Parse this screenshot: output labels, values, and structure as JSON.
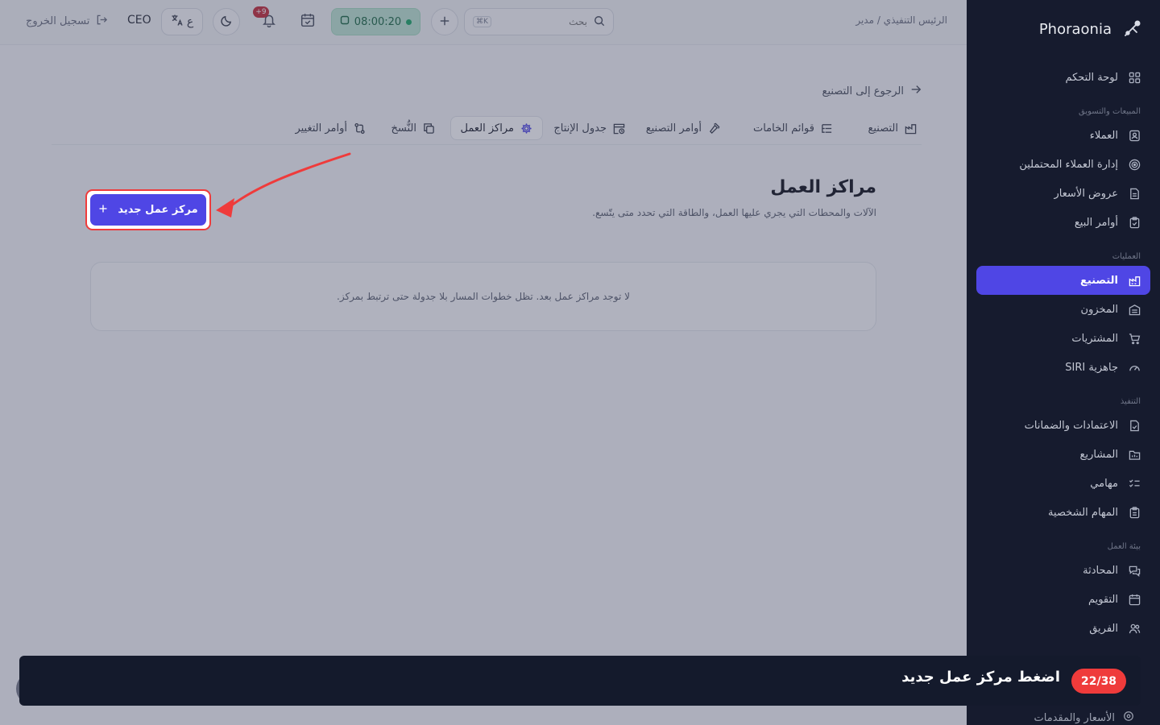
{
  "sidebar": {
    "brand": "Phoraonia",
    "items": [
      {
        "label": "لوحة التحكم",
        "icon": "grid-icon"
      },
      {
        "section": "المبيعات والتسويق"
      },
      {
        "label": "العملاء",
        "icon": "contact-icon"
      },
      {
        "label": "إدارة العملاء المحتملين",
        "icon": "target-icon"
      },
      {
        "label": "عروض الأسعار",
        "icon": "document-icon"
      },
      {
        "label": "أوامر البيع",
        "icon": "clipboard-icon"
      },
      {
        "section": "العمليات"
      },
      {
        "label": "التصنيع",
        "icon": "factory-icon",
        "active": true
      },
      {
        "label": "المخزون",
        "icon": "warehouse-icon"
      },
      {
        "label": "المشتريات",
        "icon": "cart-icon"
      },
      {
        "label": "جاهزية SIRI",
        "icon": "gauge-icon"
      },
      {
        "section": "التنفيذ"
      },
      {
        "label": "الاعتمادات والضمانات",
        "icon": "file-check-icon"
      },
      {
        "label": "المشاريع",
        "icon": "folder-icon"
      },
      {
        "label": "مهامي",
        "icon": "checklist-icon"
      },
      {
        "label": "المهام الشخصية",
        "icon": "clipboard-list-icon"
      },
      {
        "section": "بيئة العمل"
      },
      {
        "label": "المحادثة",
        "icon": "chat-icon"
      },
      {
        "label": "التقويم",
        "icon": "calendar-icon"
      },
      {
        "label": "الفريق",
        "icon": "users-icon"
      }
    ],
    "peek_label": "الأسعار والمقدمات"
  },
  "topbar": {
    "breadcrumb": "الرئيس التنفيذي / مدير",
    "search_placeholder": "بحث",
    "search_shortcut": "K⌘",
    "timer": "08:00:20",
    "notifications_badge": "+9",
    "lang_label": "ع",
    "user_role": "CEO",
    "logout_label": "تسجيل الخروج"
  },
  "main": {
    "back_label": "الرجوع إلى التصنيع",
    "tabs": [
      {
        "label": "التصنيع",
        "icon": "factory-icon"
      },
      {
        "label": "قوائم الخامات",
        "icon": "list-tree-icon"
      },
      {
        "label": "أوامر التصنيع",
        "icon": "hammer-icon"
      },
      {
        "label": "جدول الإنتاج",
        "icon": "calendar-clock-icon"
      },
      {
        "label": "مراكز العمل",
        "icon": "cog-icon",
        "active": true
      },
      {
        "label": "النُّسخ",
        "icon": "copy-icon"
      },
      {
        "label": "أوامر التغيير",
        "icon": "git-compare-icon"
      }
    ],
    "title": "مراكز العمل",
    "subtitle": "الآلات والمحطات التي يجري عليها العمل، والطاقة التي تحدد متى يتّسع.",
    "new_button_label": "مركز عمل جديد",
    "empty_message": "لا توجد مراكز عمل بعد. تظل خطوات المسار بلا جدولة حتى ترتبط بمركز."
  },
  "tour": {
    "counter": "22/38",
    "instruction": "اضغط مركز عمل جديد"
  },
  "colors": {
    "accent": "#4f46e5",
    "sidebar_bg": "#161b2e",
    "highlight": "#ef3b3b",
    "timer_bg": "#bfe6d3"
  }
}
